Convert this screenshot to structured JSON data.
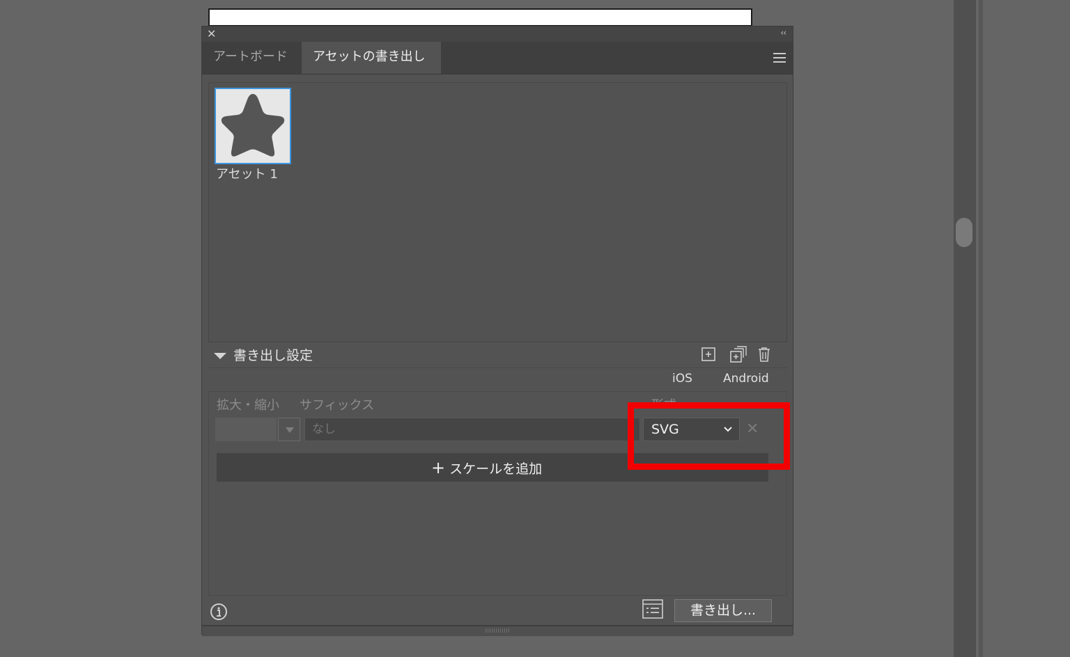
{
  "panel": {
    "close_glyph": "✕",
    "collapse_glyph": "‹‹",
    "tabs": [
      {
        "label": "アートボード",
        "active": false
      },
      {
        "label": "アセットの書き出し",
        "active": true
      }
    ]
  },
  "assets": [
    {
      "label": "アセット 1",
      "icon": "star-icon",
      "selected": true
    }
  ],
  "export_settings": {
    "title": "書き出し設定",
    "presets": {
      "ios": "iOS",
      "android": "Android"
    },
    "columns": {
      "scale": "拡大・縮小",
      "suffix": "サフィックス",
      "format": "形式"
    },
    "row": {
      "scale_value": "",
      "suffix_placeholder": "なし",
      "format_value": "SVG",
      "remove_glyph": "✕"
    },
    "add_scale_plus": "+",
    "add_scale_label": "スケールを追加"
  },
  "footer": {
    "export_label": "書き出し..."
  },
  "colors": {
    "highlight": "#f20000",
    "selection": "#3c95e0"
  }
}
